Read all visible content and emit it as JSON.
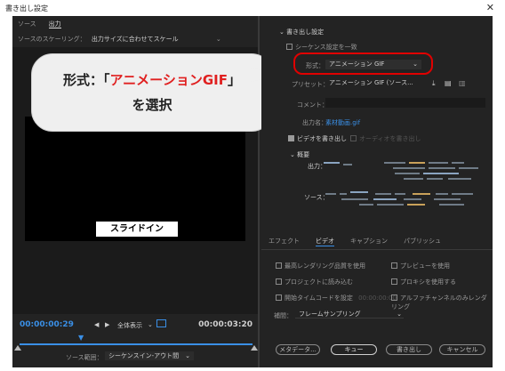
{
  "window": {
    "title": "書き出し設定",
    "close_glyph": "✕"
  },
  "left_panel": {
    "tabs": [
      {
        "label": "ソース"
      },
      {
        "label": "出力"
      }
    ],
    "scaling_label": "ソースのスケーリング：",
    "scaling_value": "出力サイズに合わせてスケール",
    "preview_caption": "スライドイン",
    "callout": {
      "line1_prefix": "形式：「",
      "line1_highlight": "アニメーションGIF",
      "line1_suffix": "」",
      "line2": "を選択"
    },
    "timeline": {
      "current_time": "00:00:00:29",
      "end_time": "00:00:03:20",
      "zoom_value": "全体表示",
      "source_range_label": "ソース範囲：",
      "source_range_value": "シーケンスイン-アウト間",
      "playhead_position": 0.27
    }
  },
  "right_panel": {
    "export_settings_header": "書き出し設定",
    "match_sequence_label": "シーケンス設定を一致",
    "format_label": "形式：",
    "format_value": "アニメーション GIF",
    "preset_label": "プリセット：",
    "preset_value": "アニメーション GIF (ソース...",
    "comment_label": "コメント：",
    "output_name_label": "出力名：",
    "output_name_value": "素材動画.gif",
    "export_video_label": "ビデオを書き出し",
    "export_audio_label": "オーディオを書き出し",
    "summary_header": "概要",
    "summary_output_label": "出力：",
    "summary_source_label": "ソース：",
    "tabs": [
      {
        "label": "エフェクト"
      },
      {
        "label": "ビデオ"
      },
      {
        "label": "キャプション"
      },
      {
        "label": "パブリッシュ"
      }
    ],
    "options": {
      "max_render_quality": "最高レンダリング品質を使用",
      "use_previews": "プレビューを使用",
      "import_into_project": "プロジェクトに読み込む",
      "use_proxies": "プロキシを使用する",
      "set_start_timecode": "開始タイムコードを設定",
      "start_timecode_value": "00:00:00:00",
      "alpha_only": "アルファチャンネルのみレンダリング"
    },
    "interpolation_label": "補間：",
    "interpolation_value": "フレームサンプリング",
    "buttons": {
      "metadata": "メタデータ...",
      "queue": "キュー",
      "export": "書き出し",
      "cancel": "キャンセル"
    }
  },
  "colors": {
    "accent_blue": "#3a8fe6",
    "highlight_red": "#e00000",
    "panel_bg": "#232323"
  }
}
